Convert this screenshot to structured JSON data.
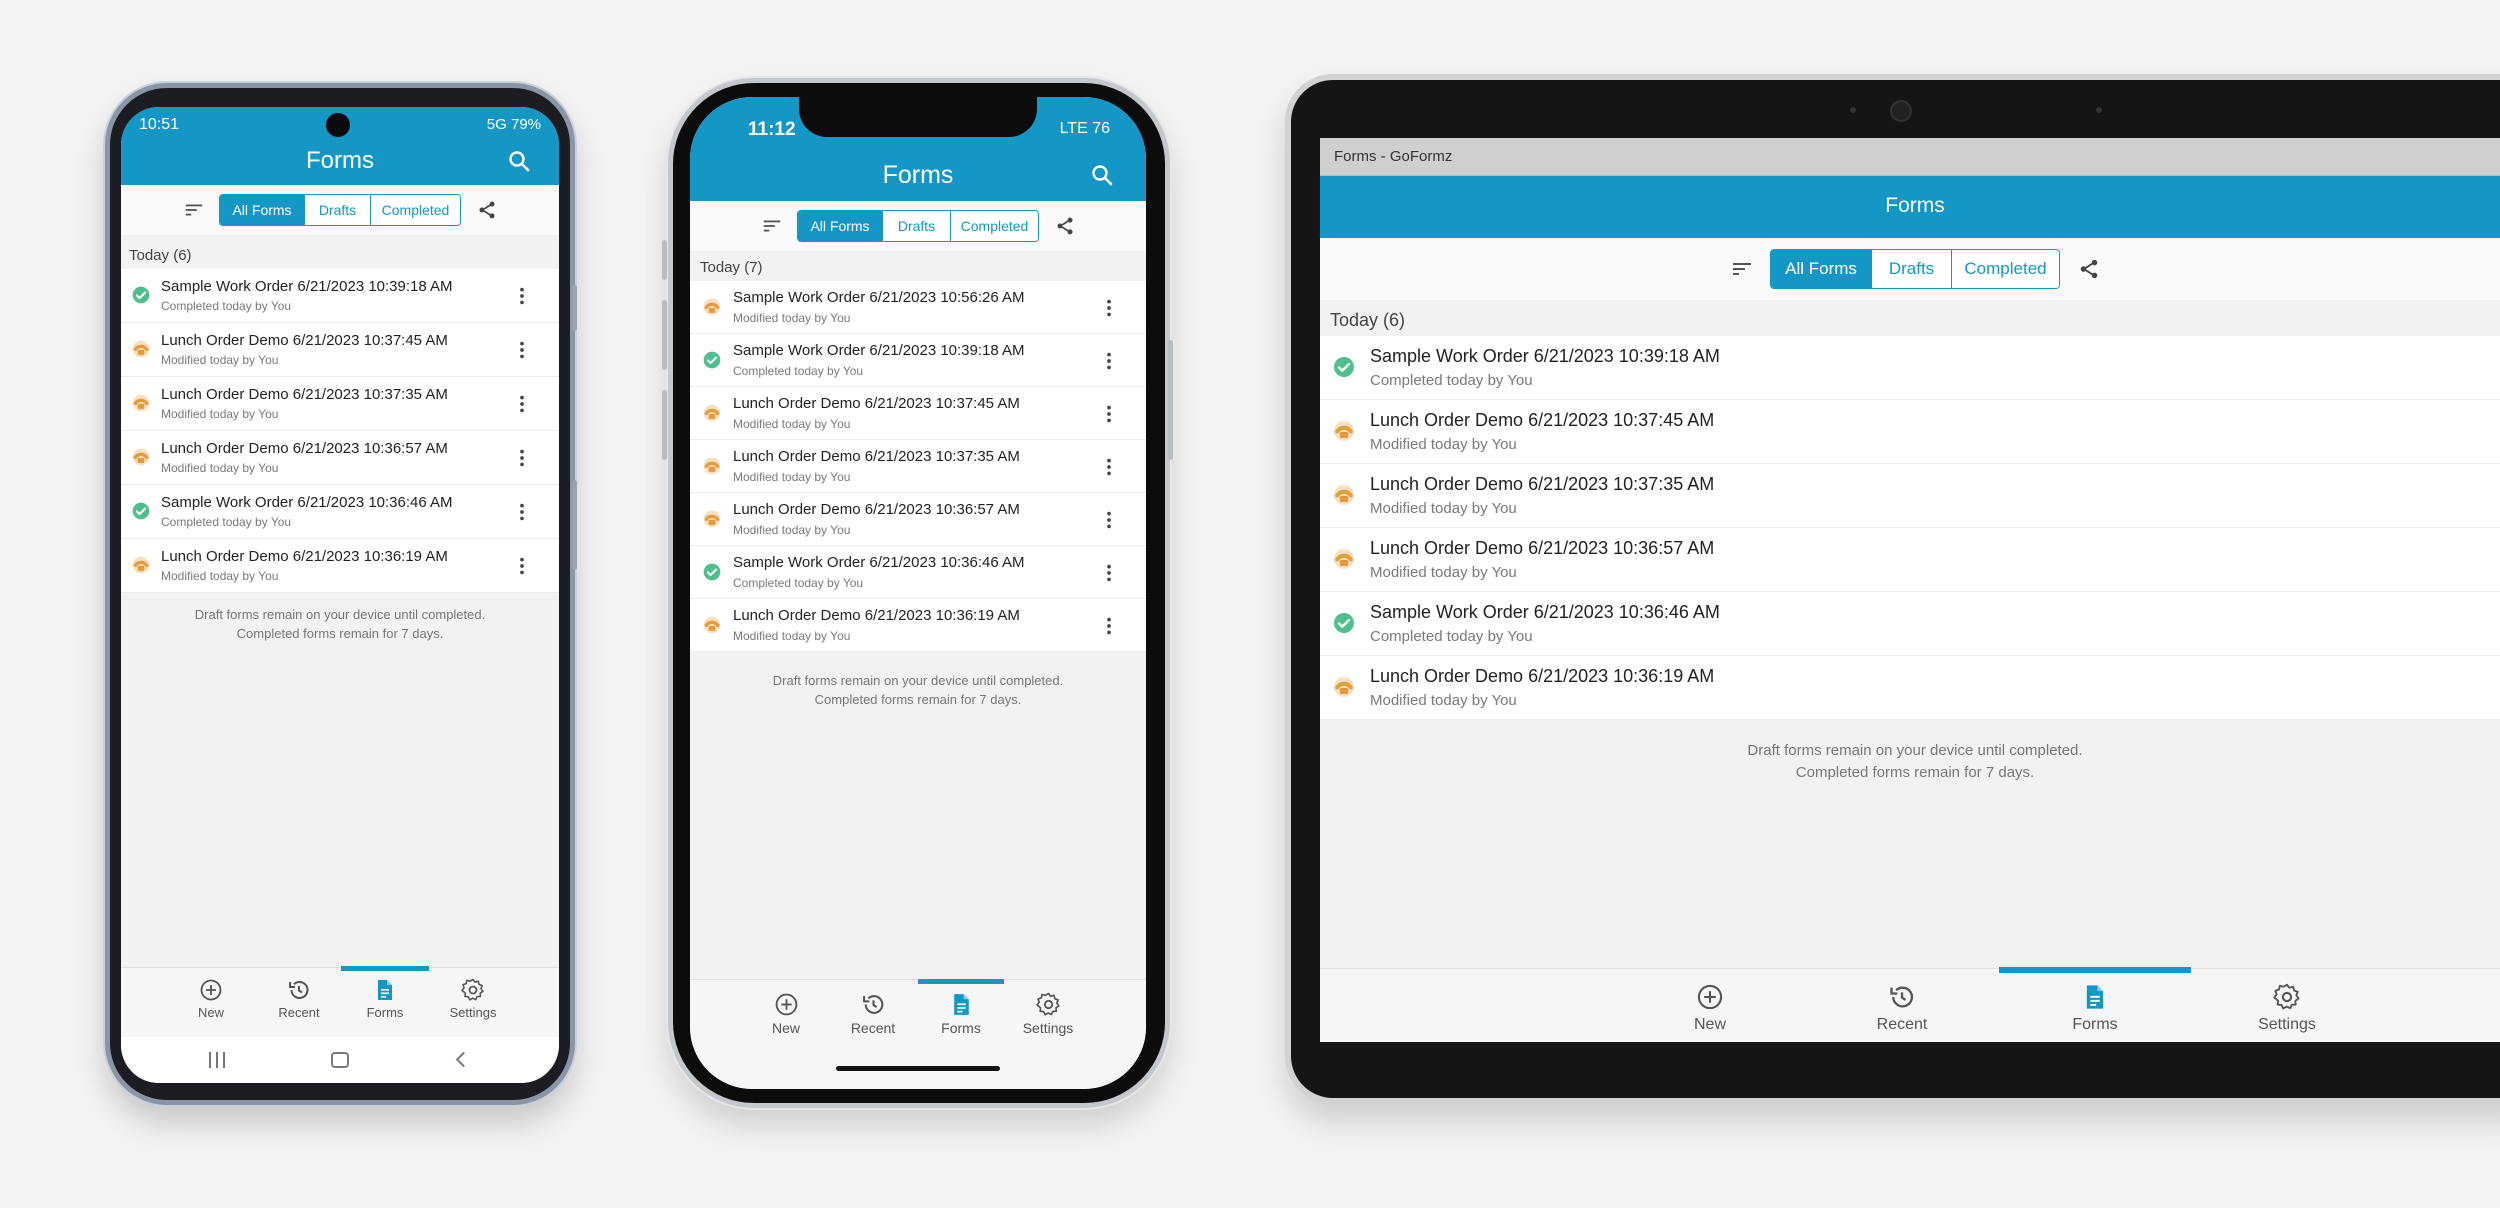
{
  "colors": {
    "brand": "#1597c6",
    "completed": "#4fbf8f",
    "draft": "#e59b3a"
  },
  "app": {
    "title": "Forms",
    "window_title": "Forms - GoFormz",
    "filters": [
      "All Forms",
      "Drafts",
      "Completed"
    ],
    "footnote_line1": "Draft forms remain on your device until completed.",
    "footnote_line2": "Completed forms remain for 7 days.",
    "nav": [
      "New",
      "Recent",
      "Forms",
      "Settings"
    ]
  },
  "android": {
    "time": "10:51",
    "status_right": "5G 79%",
    "group": "Today (6)",
    "items": [
      {
        "name": "Sample Work Order 6/21/2023 10:39:18 AM",
        "sub": "Completed today by You",
        "status": "completed"
      },
      {
        "name": "Lunch Order Demo 6/21/2023 10:37:45 AM",
        "sub": "Modified today by You",
        "status": "draft"
      },
      {
        "name": "Lunch Order Demo 6/21/2023 10:37:35 AM",
        "sub": "Modified today by You",
        "status": "draft"
      },
      {
        "name": "Lunch Order Demo 6/21/2023 10:36:57 AM",
        "sub": "Modified today by You",
        "status": "draft"
      },
      {
        "name": "Sample Work Order 6/21/2023 10:36:46 AM",
        "sub": "Completed today by You",
        "status": "completed"
      },
      {
        "name": "Lunch Order Demo 6/21/2023 10:36:19 AM",
        "sub": "Modified today by You",
        "status": "draft"
      }
    ]
  },
  "iphone": {
    "time": "11:12",
    "status_right": "LTE 76",
    "group": "Today (7)",
    "items": [
      {
        "name": "Sample Work Order 6/21/2023 10:56:26 AM",
        "sub": "Modified today by You",
        "status": "draft"
      },
      {
        "name": "Sample Work Order 6/21/2023 10:39:18 AM",
        "sub": "Completed today by You",
        "status": "completed"
      },
      {
        "name": "Lunch Order Demo 6/21/2023 10:37:45 AM",
        "sub": "Modified today by You",
        "status": "draft"
      },
      {
        "name": "Lunch Order Demo 6/21/2023 10:37:35 AM",
        "sub": "Modified today by You",
        "status": "draft"
      },
      {
        "name": "Lunch Order Demo 6/21/2023 10:36:57 AM",
        "sub": "Modified today by You",
        "status": "draft"
      },
      {
        "name": "Sample Work Order 6/21/2023 10:36:46 AM",
        "sub": "Completed today by You",
        "status": "completed"
      },
      {
        "name": "Lunch Order Demo 6/21/2023 10:36:19 AM",
        "sub": "Modified today by You",
        "status": "draft"
      }
    ]
  },
  "tablet": {
    "group": "Today (6)",
    "items": [
      {
        "name": "Sample Work Order 6/21/2023 10:39:18 AM",
        "sub": "Completed today by You",
        "status": "completed"
      },
      {
        "name": "Lunch Order Demo 6/21/2023 10:37:45 AM",
        "sub": "Modified today by You",
        "status": "draft"
      },
      {
        "name": "Lunch Order Demo 6/21/2023 10:37:35 AM",
        "sub": "Modified today by You",
        "status": "draft"
      },
      {
        "name": "Lunch Order Demo 6/21/2023 10:36:57 AM",
        "sub": "Modified today by You",
        "status": "draft"
      },
      {
        "name": "Sample Work Order 6/21/2023 10:36:46 AM",
        "sub": "Completed today by You",
        "status": "completed"
      },
      {
        "name": "Lunch Order Demo 6/21/2023 10:36:19 AM",
        "sub": "Modified today by You",
        "status": "draft"
      }
    ]
  }
}
